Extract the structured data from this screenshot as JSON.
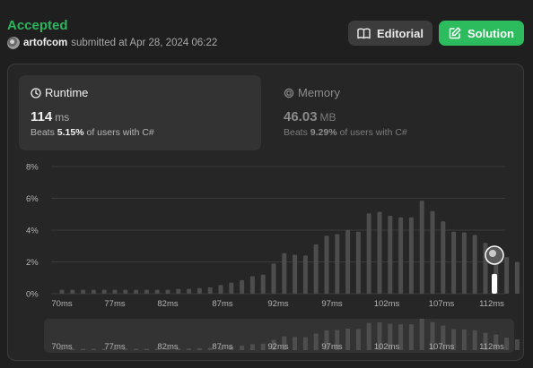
{
  "header": {
    "status": "Accepted",
    "username": "artofcom",
    "submitted_text": "submitted at Apr 28, 2024 06:22"
  },
  "buttons": {
    "editorial": "Editorial",
    "solution": "Solution"
  },
  "runtime_card": {
    "title": "Runtime",
    "value": "114",
    "unit": "ms",
    "beats_prefix": "Beats",
    "beats_percent": "5.15%",
    "beats_suffix": "of users with C#"
  },
  "memory_card": {
    "title": "Memory",
    "value": "46.03",
    "unit": "MB",
    "beats_prefix": "Beats",
    "beats_percent": "9.29%",
    "beats_suffix": "of users with C#"
  },
  "colors": {
    "accepted": "#2db55d",
    "solution_button": "#2cbb5d",
    "bar": "#4d4d4d",
    "highlight_bar": "#ffffff"
  },
  "chart_data": {
    "type": "bar",
    "y_ticks": [
      "8%",
      "6%",
      "4%",
      "2%",
      "0%"
    ],
    "x_ticks": [
      "70ms",
      "77ms",
      "82ms",
      "87ms",
      "92ms",
      "97ms",
      "102ms",
      "107ms",
      "112ms"
    ],
    "ylim": [
      0,
      8
    ],
    "grid": true,
    "x_range": [
      70,
      112
    ],
    "values": [
      0.25,
      0.25,
      0.25,
      0.25,
      0.25,
      0.25,
      0.25,
      0.25,
      0.25,
      0.25,
      0.25,
      0.3,
      0.3,
      0.35,
      0.4,
      0.55,
      0.7,
      0.85,
      1.1,
      1.2,
      1.9,
      2.55,
      2.45,
      2.4,
      3.1,
      3.65,
      3.75,
      4.0,
      3.9,
      5.05,
      5.15,
      4.9,
      4.8,
      4.8,
      5.85,
      5.2,
      4.55,
      3.9,
      3.85,
      3.7,
      3.2,
      2.9,
      2.3,
      2.0,
      1.25
    ],
    "highlight": {
      "x_label": "114ms",
      "value": 1.25
    }
  }
}
